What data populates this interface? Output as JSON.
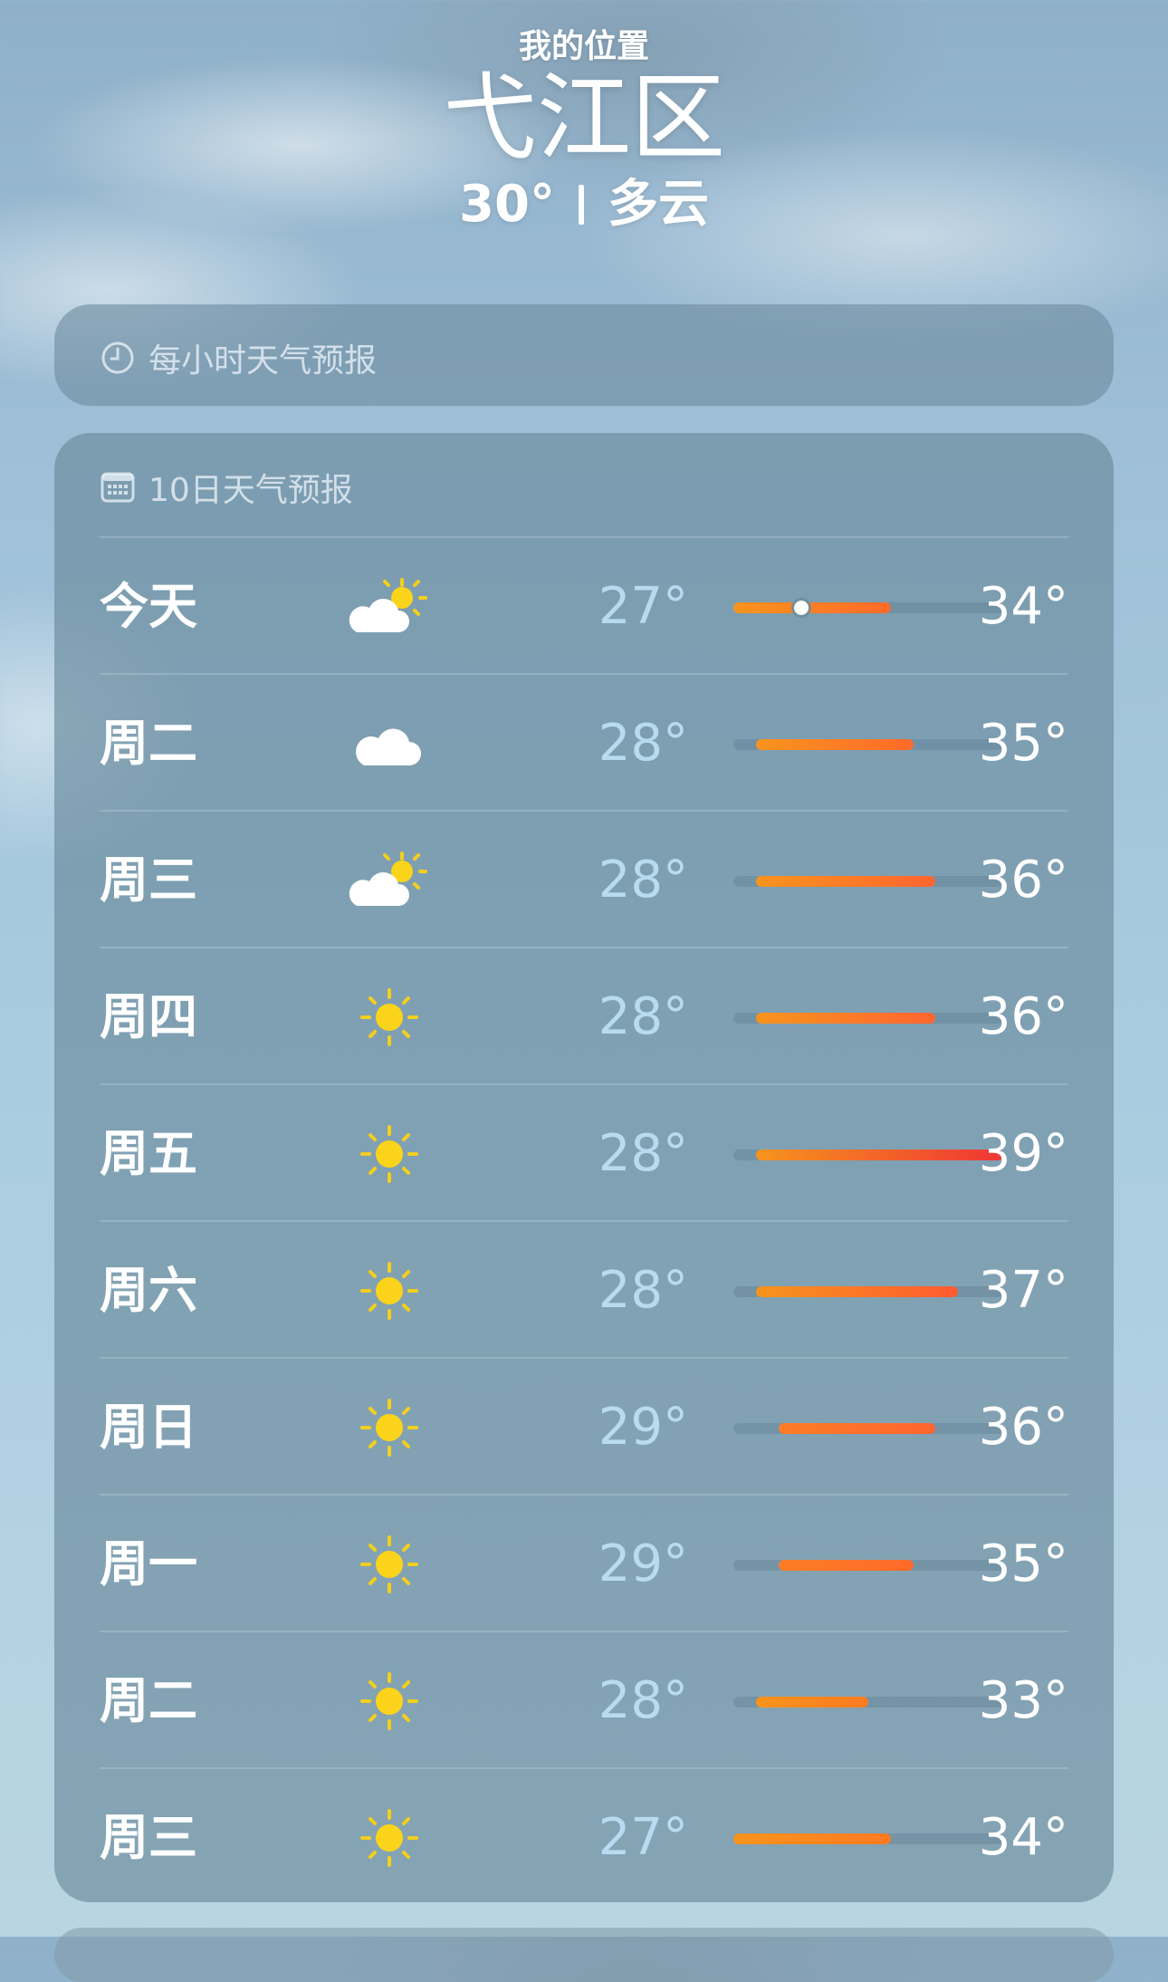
{
  "header": {
    "location_label": "我的位置",
    "city": "弋江区",
    "current_temp": "30°",
    "condition": "多云"
  },
  "hourly_card": {
    "title": "每小时天气预报",
    "icon": "clock-icon"
  },
  "daily_card": {
    "title": "10日天气预报",
    "icon": "calendar-icon",
    "scale_min": 27,
    "scale_max": 39,
    "days": [
      {
        "day": "今天",
        "icon": "partly-cloudy-sun-icon",
        "low": "27°",
        "high": "34°",
        "low_value": 27,
        "high_value": 34,
        "current_value": 30,
        "colors": [
          "#f7941d",
          "#ff6a2a"
        ]
      },
      {
        "day": "周二",
        "icon": "cloud-icon",
        "low": "28°",
        "high": "35°",
        "low_value": 28,
        "high_value": 35,
        "colors": [
          "#f7941d",
          "#ff6a2a"
        ]
      },
      {
        "day": "周三",
        "icon": "partly-cloudy-sun-icon",
        "low": "28°",
        "high": "36°",
        "low_value": 28,
        "high_value": 36,
        "colors": [
          "#f7941d",
          "#ff6530"
        ]
      },
      {
        "day": "周四",
        "icon": "sun-icon",
        "low": "28°",
        "high": "36°",
        "low_value": 28,
        "high_value": 36,
        "colors": [
          "#f7941d",
          "#ff6530"
        ]
      },
      {
        "day": "周五",
        "icon": "sun-icon",
        "low": "28°",
        "high": "39°",
        "low_value": 28,
        "high_value": 39,
        "colors": [
          "#f7941d",
          "#ef3535"
        ]
      },
      {
        "day": "周六",
        "icon": "sun-icon",
        "low": "28°",
        "high": "37°",
        "low_value": 28,
        "high_value": 37,
        "colors": [
          "#f7941d",
          "#ff5a30"
        ]
      },
      {
        "day": "周日",
        "icon": "sun-icon",
        "low": "29°",
        "high": "36°",
        "low_value": 29,
        "high_value": 36,
        "colors": [
          "#fb7d25",
          "#ff6530"
        ]
      },
      {
        "day": "周一",
        "icon": "sun-icon",
        "low": "29°",
        "high": "35°",
        "low_value": 29,
        "high_value": 35,
        "colors": [
          "#fb7d25",
          "#ff6a2a"
        ]
      },
      {
        "day": "周二",
        "icon": "sun-icon",
        "low": "28°",
        "high": "33°",
        "low_value": 28,
        "high_value": 33,
        "colors": [
          "#f7941d",
          "#ff7a22"
        ]
      },
      {
        "day": "周三",
        "icon": "sun-icon",
        "low": "27°",
        "high": "34°",
        "low_value": 27,
        "high_value": 34,
        "colors": [
          "#f7941d",
          "#ff7a22"
        ]
      }
    ]
  }
}
